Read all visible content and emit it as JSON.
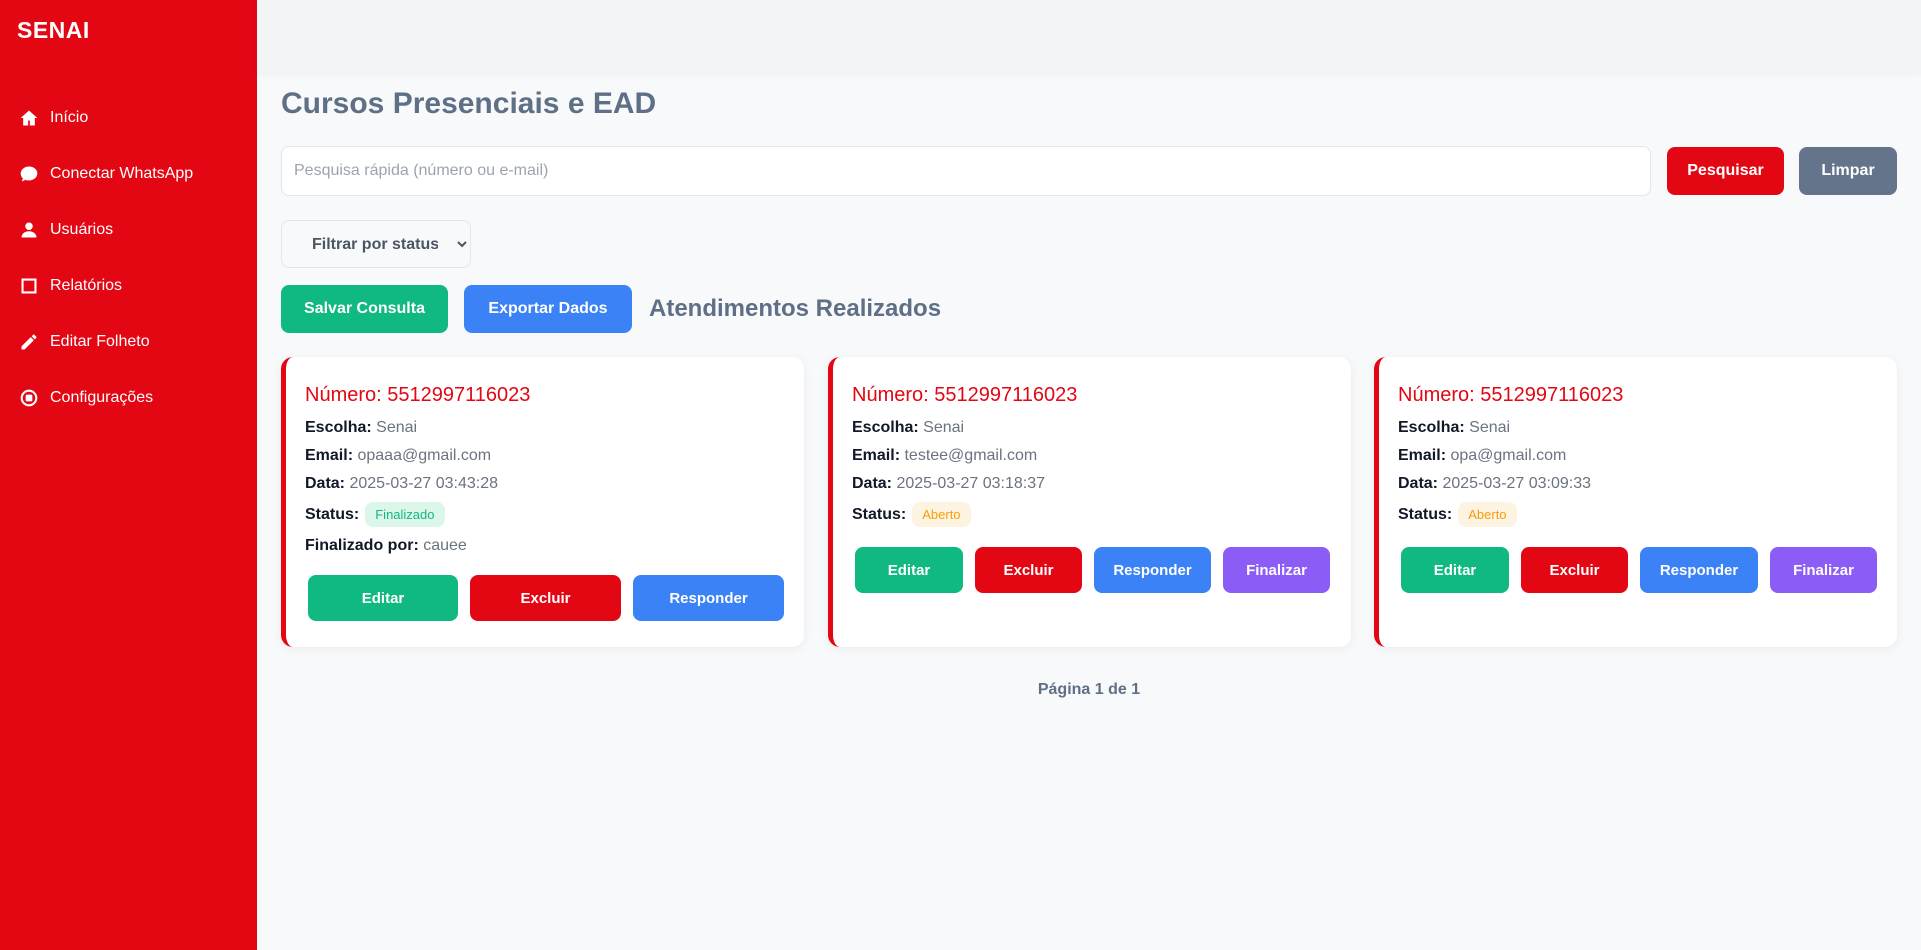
{
  "brand": "SENAI",
  "sidebar": {
    "items": [
      {
        "label": "Início",
        "icon": "home-icon"
      },
      {
        "label": "Conectar WhatsApp",
        "icon": "chat-bubble-icon"
      },
      {
        "label": "Usuários",
        "icon": "user-icon"
      },
      {
        "label": "Relatórios",
        "icon": "square-icon"
      },
      {
        "label": "Editar Folheto",
        "icon": "pencil-icon"
      },
      {
        "label": "Configurações",
        "icon": "circle-dot-icon"
      }
    ]
  },
  "main": {
    "title": "Cursos Presenciais e EAD",
    "search": {
      "placeholder": "Pesquisa rápida (número ou e-mail)",
      "value": ""
    },
    "search_button": "Pesquisar",
    "clear_button": "Limpar",
    "status_filter": {
      "selected": "Filtrar por status"
    },
    "save_button": "Salvar Consulta",
    "export_button": "Exportar Dados",
    "section_title": "Atendimentos Realizados"
  },
  "labels": {
    "escolha": "Escolha:",
    "email": "Email:",
    "data": "Data:",
    "status": "Status:",
    "finalizado_por": "Finalizado por:"
  },
  "card_buttons": {
    "edit": "Editar",
    "delete": "Excluir",
    "respond": "Responder",
    "finish": "Finalizar"
  },
  "cards": [
    {
      "number": "Número: 5512997116023",
      "escolha": "Senai",
      "email": "opaaa@gmail.com",
      "data": "2025-03-27 03:43:28",
      "status": "Finalizado",
      "finalizado_por": "cauee"
    },
    {
      "number": "Número: 5512997116023",
      "escolha": "Senai",
      "email": "testee@gmail.com",
      "data": "2025-03-27 03:18:37",
      "status": "Aberto"
    },
    {
      "number": "Número: 5512997116023",
      "escolha": "Senai",
      "email": "opa@gmail.com",
      "data": "2025-03-27 03:09:33",
      "status": "Aberto"
    }
  ],
  "pagination": "Página 1 de 1",
  "colors": {
    "brand_red": "#e30613",
    "success_green": "#10b981",
    "primary_blue": "#3b82f6",
    "purple": "#8b5cf6",
    "slate": "#64748b"
  }
}
